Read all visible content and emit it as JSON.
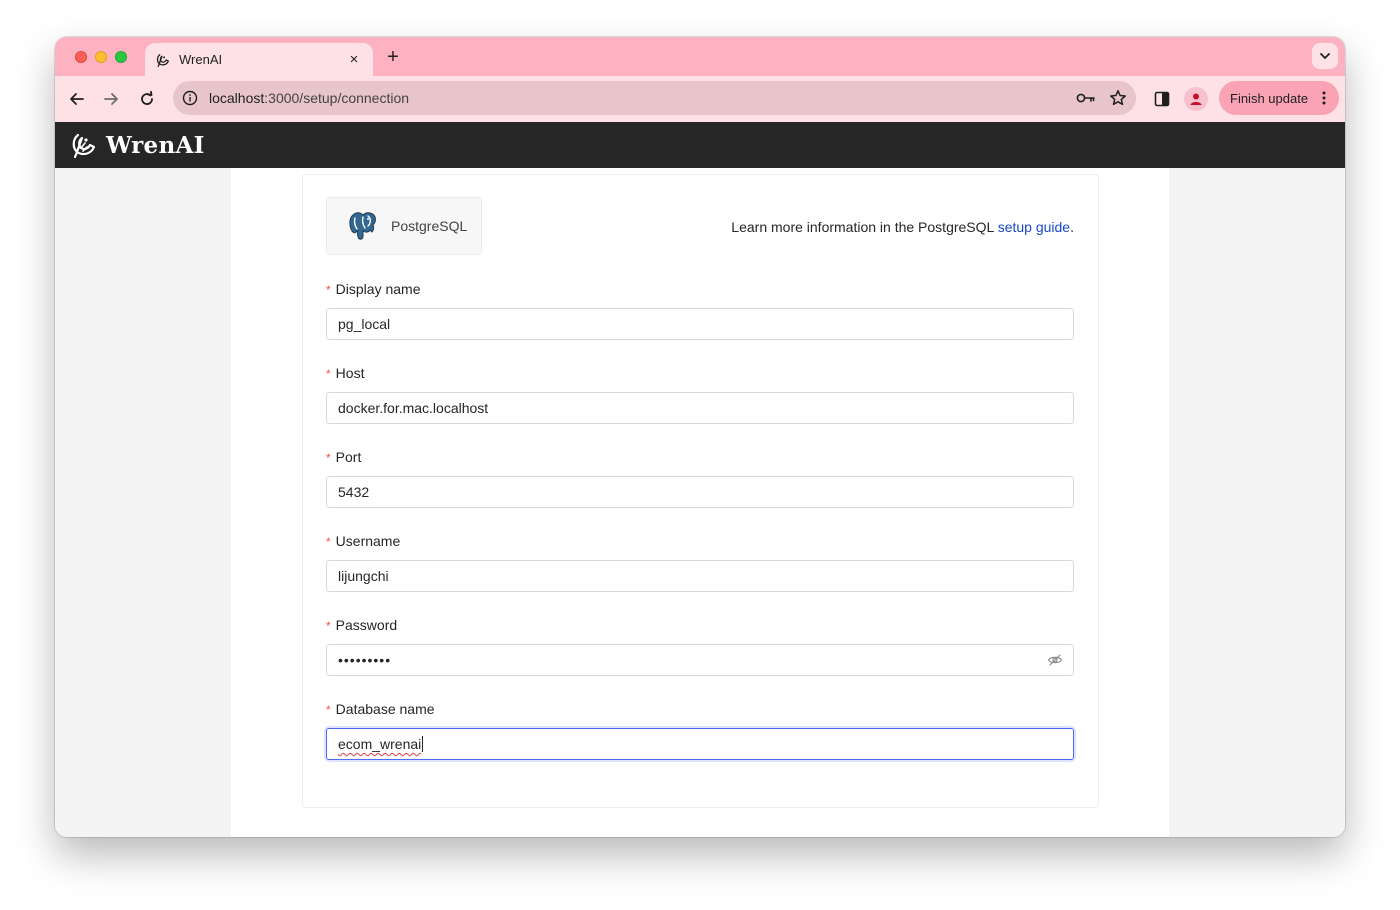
{
  "browser": {
    "tab_title": "WrenAI",
    "new_tab_symbol": "+",
    "close_symbol": "×",
    "url_host": "localhost",
    "url_path": ":3000/setup/connection",
    "finish_update_label": "Finish update",
    "colors": {
      "tabstrip": "#fdb1c1",
      "toolbar": "#fde1e7",
      "omnibox": "#e8c4cb"
    },
    "icons": [
      "back-arrow-icon",
      "forward-arrow-icon",
      "reload-icon",
      "site-info-icon",
      "password-key-icon",
      "bookmark-star-icon",
      "side-panel-icon",
      "profile-icon",
      "more-vert-icon",
      "tab-search-icon"
    ]
  },
  "app": {
    "brand": "WrenAI",
    "header_color": "#262626"
  },
  "datasource": {
    "name": "PostgreSQL",
    "learn_more_prefix": "Learn more information in the PostgreSQL ",
    "learn_more_link": "setup guide",
    "learn_more_suffix": "."
  },
  "form": {
    "required_mark": "*",
    "fields": [
      {
        "label": "Display name",
        "value": "pg_local"
      },
      {
        "label": "Host",
        "value": "docker.for.mac.localhost"
      },
      {
        "label": "Port",
        "value": "5432"
      },
      {
        "label": "Username",
        "value": "lijungchi"
      },
      {
        "label": "Password",
        "value": "•••••••••"
      },
      {
        "label": "Database name",
        "value": "ecom_wrenai"
      }
    ],
    "focus_color": "#4a6cf7"
  }
}
